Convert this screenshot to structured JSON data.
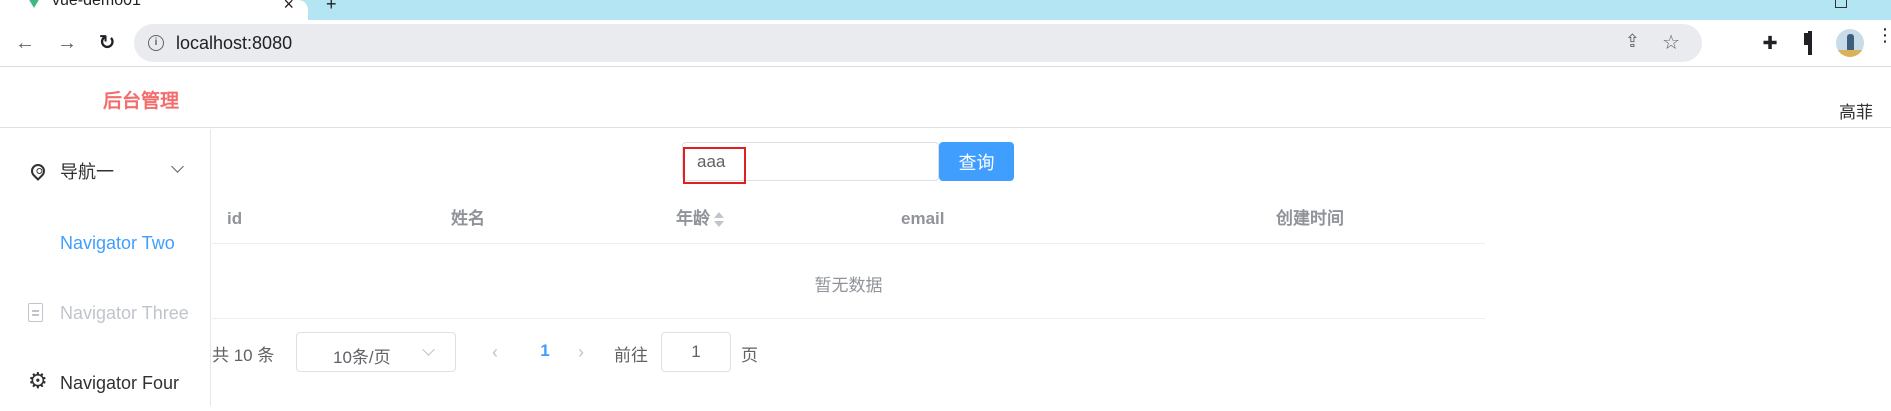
{
  "browser": {
    "tab_title": "vue-demo01",
    "tab_close": "×",
    "new_tab": "+",
    "url": "localhost:8080",
    "back_glyph": "←",
    "forward_glyph": "→",
    "reload_glyph": "↻",
    "share_glyph": "⇪",
    "star_glyph": "☆",
    "puzzle_glyph": "✚",
    "menu_glyph": "⋮",
    "accent": "#b3e5f2"
  },
  "header": {
    "logo": "后台管理",
    "user": "高菲",
    "logo_color": "#f56c6c"
  },
  "sidebar": {
    "items": [
      {
        "label": "导航一",
        "icon": "location-icon",
        "state": "default"
      },
      {
        "label": "Navigator Two",
        "icon": "none",
        "state": "active"
      },
      {
        "label": "Navigator Three",
        "icon": "document-icon",
        "state": "disabled"
      },
      {
        "label": "Navigator Four",
        "icon": "gear-icon",
        "state": "default"
      }
    ],
    "gear_glyph": "⚙",
    "active_color": "#409eff"
  },
  "search": {
    "value": "aaa",
    "placeholder": "",
    "button_label": "查询"
  },
  "table": {
    "columns": [
      "id",
      "姓名",
      "年龄",
      "email",
      "创建时间"
    ],
    "empty_text": "暂无数据"
  },
  "pagination": {
    "total_text": "共 10 条",
    "page_size": "10条/页",
    "current_page": "1",
    "goto_label": "前往",
    "goto_value": "1",
    "goto_unit": "页",
    "prev_glyph": "‹",
    "next_glyph": "›"
  }
}
